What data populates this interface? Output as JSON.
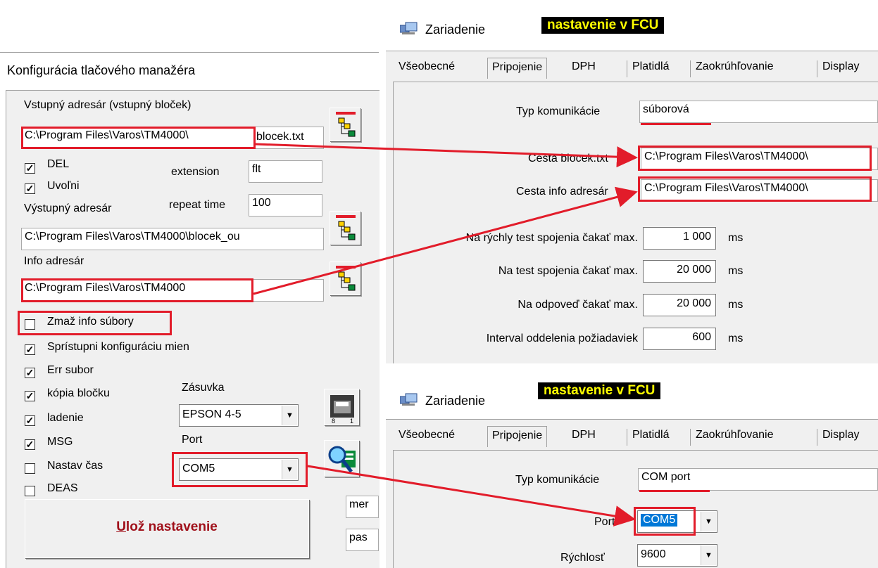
{
  "left": {
    "title": "Konfigurácia tlačového manažéra",
    "input_dir_label": "Vstupný adresár (vstupný bloček)",
    "input_dir_value": "C:\\Program Files\\Varos\\TM4000\\",
    "input_file_value": "blocek.txt",
    "del_label": "DEL",
    "uvolni_label": "Uvoľni",
    "extension_label": "extension",
    "extension_value": "flt",
    "repeat_label": "repeat time",
    "repeat_value": "100",
    "output_dir_label": "Výstupný adresár",
    "output_dir_value": "C:\\Program Files\\Varos\\TM4000\\blocek_ou",
    "info_dir_label": "Info adresár",
    "info_dir_value": "C:\\Program Files\\Varos\\TM4000",
    "zmaz_label": "Zmaž info súbory",
    "checks": [
      {
        "label": "Sprístupni konfiguráciu mien",
        "checked": true
      },
      {
        "label": "Err subor",
        "checked": true
      },
      {
        "label": "kópia bločku",
        "checked": true
      },
      {
        "label": "ladenie",
        "checked": true
      },
      {
        "label": "MSG",
        "checked": true
      },
      {
        "label": "Nastav čas",
        "checked": false
      },
      {
        "label": "DEAS",
        "checked": false
      }
    ],
    "zasuvka_label": "Zásuvka",
    "zasuvka_value": "EPSON 4-5",
    "port_label": "Port",
    "port_value": "COM5",
    "save_button_prefix": "U",
    "save_button_rest": "lož nastavenie",
    "side_field_1": "mer",
    "side_field_2": "pas"
  },
  "top_right": {
    "window_title": "Zariadenie",
    "badge": "nastavenie v FCU",
    "tabs": [
      "Všeobecné",
      "Pripojenie",
      "DPH",
      "Platidlá",
      "Zaokrúhľovanie",
      "Display"
    ],
    "typ_label": "Typ komunikácie",
    "typ_value": "súborová",
    "cesta_blocek_label": "Cesta blocek.txt",
    "cesta_blocek_value": "C:\\Program Files\\Varos\\TM4000\\",
    "cesta_info_label": "Cesta info adresár",
    "cesta_info_value": "C:\\Program Files\\Varos\\TM4000\\",
    "timings": [
      {
        "label": "Na rýchly test spojenia čakať max.",
        "value": "1 000",
        "unit": "ms"
      },
      {
        "label": "Na test spojenia čakať max.",
        "value": "20 000",
        "unit": "ms"
      },
      {
        "label": "Na odpoveď čakať max.",
        "value": "20 000",
        "unit": "ms"
      },
      {
        "label": "Interval oddelenia požiadaviek",
        "value": "600",
        "unit": "ms"
      }
    ]
  },
  "bottom_right": {
    "window_title": "Zariadenie",
    "badge": "nastavenie v FCU",
    "tabs": [
      "Všeobecné",
      "Pripojenie",
      "DPH",
      "Platidlá",
      "Zaokrúhľovanie",
      "Display"
    ],
    "typ_label": "Typ komunikácie",
    "typ_value": "COM port",
    "port_label": "Port",
    "port_value": "COM5",
    "speed_label": "Rýchlosť",
    "speed_value": "9600"
  },
  "colors": {
    "highlight": "#e21c2a",
    "badge_bg": "#000000",
    "badge_text": "#ffff00",
    "selection": "#0078d7"
  }
}
